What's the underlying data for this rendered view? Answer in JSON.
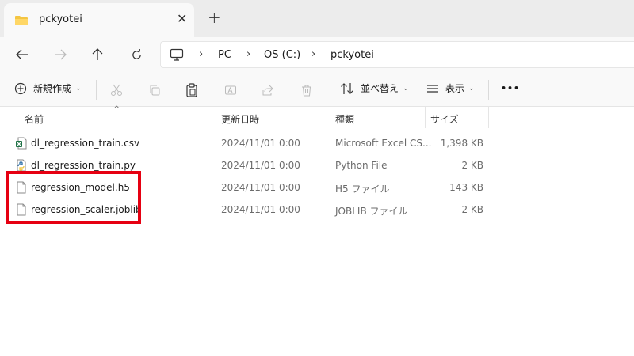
{
  "tab": {
    "title": "pckyotei",
    "close": "✕",
    "new_tab": "+"
  },
  "breadcrumb": {
    "items": [
      "PC",
      "OS (C:)",
      "pckyotei"
    ],
    "separator": "›"
  },
  "commands": {
    "new": "新規作成",
    "sort": "並べ替え",
    "view": "表示",
    "more": "•••"
  },
  "columns": {
    "name": "名前",
    "date": "更新日時",
    "type": "種類",
    "size": "サイズ"
  },
  "files": [
    {
      "name": "dl_regression_train.csv",
      "date": "2024/11/01 0:00",
      "type": "Microsoft Excel CS...",
      "size": "1,398 KB",
      "icon": "excel-csv-icon"
    },
    {
      "name": "dl_regression_train.py",
      "date": "2024/11/01 0:00",
      "type": "Python File",
      "size": "2 KB",
      "icon": "python-file-icon"
    },
    {
      "name": "regression_model.h5",
      "date": "2024/11/01 0:00",
      "type": "H5 ファイル",
      "size": "143 KB",
      "icon": "blank-file-icon"
    },
    {
      "name": "regression_scaler.joblib",
      "date": "2024/11/01 0:00",
      "type": "JOBLIB ファイル",
      "size": "2 KB",
      "icon": "blank-file-icon"
    }
  ],
  "colors": {
    "highlight": "#e60012",
    "folder": "#f4c542",
    "excel": "#1e7145"
  }
}
